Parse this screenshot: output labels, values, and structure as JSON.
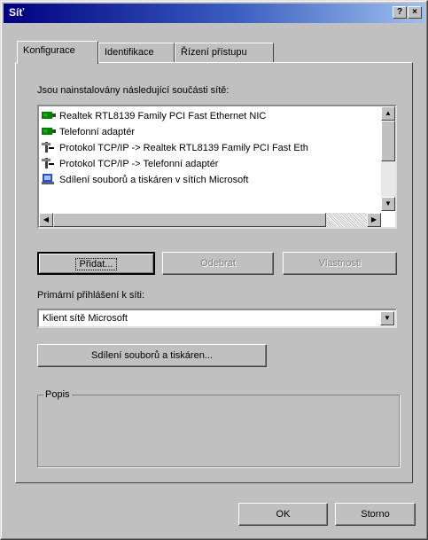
{
  "window": {
    "title": "Síť",
    "help_label": "?",
    "close_label": "×"
  },
  "tabs": [
    {
      "label": "Konfigurace"
    },
    {
      "label": "Identifikace"
    },
    {
      "label": "Řízení přístupu"
    }
  ],
  "components": {
    "heading": "Jsou nainstalovány následující součásti sítě:",
    "items": [
      {
        "label": "Realtek RTL8139 Family PCI Fast Ethernet NIC",
        "icon": "network-card-icon"
      },
      {
        "label": "Telefonní adaptér",
        "icon": "network-card-icon"
      },
      {
        "label": "Protokol TCP/IP -> Realtek RTL8139 Family PCI Fast Eth",
        "icon": "protocol-icon"
      },
      {
        "label": "Protokol TCP/IP -> Telefonní adaptér",
        "icon": "protocol-icon"
      },
      {
        "label": "Sdílení souborů a tiskáren v sítích Microsoft",
        "icon": "service-icon"
      }
    ]
  },
  "buttons": {
    "add": "Přidat...",
    "remove": "Odebrat",
    "properties": "Vlastnosti",
    "sharing": "Sdílení souborů a tiskáren...",
    "ok": "OK",
    "cancel": "Storno"
  },
  "logon": {
    "label": "Primární přihlášení k síti:",
    "value": "Klient sítě Microsoft"
  },
  "description": {
    "label": "Popis"
  },
  "colors": {
    "titlebar_start": "#000080",
    "titlebar_end": "#9ec0ee",
    "face": "#c0c0c0"
  }
}
